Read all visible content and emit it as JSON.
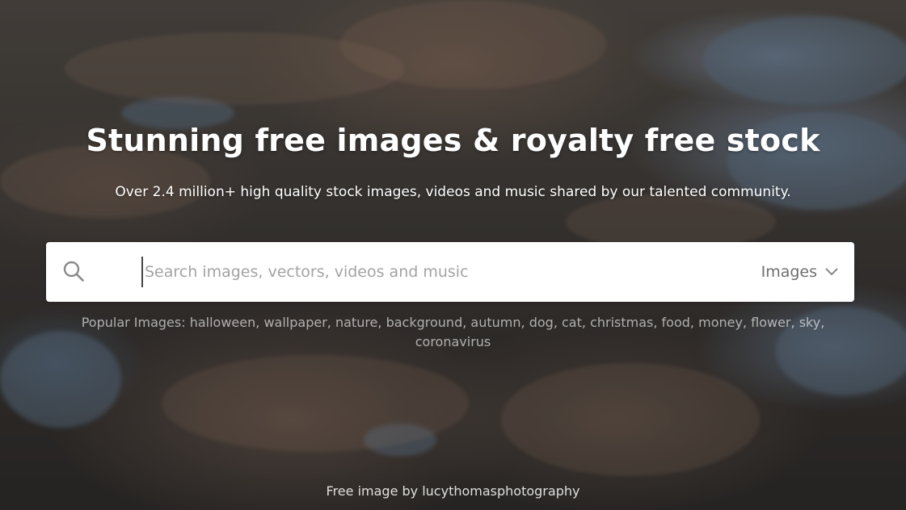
{
  "hero": {
    "title": "Stunning free images & royalty free stock",
    "subtitle": "Over 2.4 million+ high quality stock images, videos and music shared by our talented community."
  },
  "search": {
    "icon": "search-icon",
    "placeholder": "Search images, vectors, videos and music",
    "value": "",
    "type_selected": "Images",
    "type_icon": "chevron-down-icon"
  },
  "popular": {
    "label": "Popular Images:",
    "tags": [
      "halloween",
      "wallpaper",
      "nature",
      "background",
      "autumn",
      "dog",
      "cat",
      "christmas",
      "food",
      "money",
      "flower",
      "sky",
      "coronavirus"
    ]
  },
  "credit": {
    "prefix": "Free image by",
    "author": "lucythomasphotography"
  },
  "colors": {
    "search_bg": "#ffffff",
    "placeholder": "#a3a3a3",
    "select_text": "#6f6f6f",
    "headline": "#ffffff"
  }
}
